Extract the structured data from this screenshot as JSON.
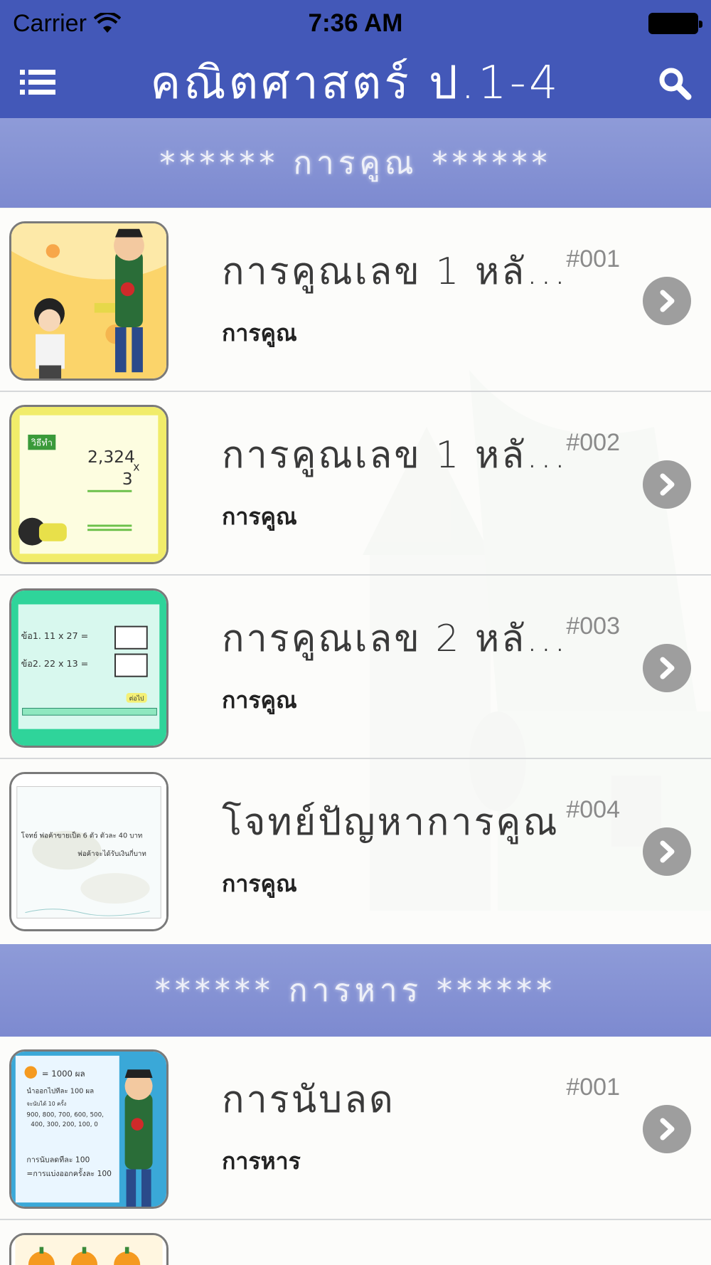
{
  "status_bar": {
    "carrier": "Carrier",
    "time": "7:36 AM"
  },
  "nav": {
    "title": "คณิตศาสตร์  ป.1-4"
  },
  "sections": [
    {
      "header": "******  การคูณ  ******",
      "items": [
        {
          "title": "การคูณเลข  1  หลั...",
          "code": "#001",
          "subtitle": "การคูณ"
        },
        {
          "title": "การคูณเลข  1  หลั...",
          "code": "#002",
          "subtitle": "การคูณ"
        },
        {
          "title": "การคูณเลข  2  หลั...",
          "code": "#003",
          "subtitle": "การคูณ"
        },
        {
          "title": "โจทย์ปัญหาการคูณ",
          "code": "#004",
          "subtitle": "การคูณ"
        }
      ]
    },
    {
      "header": "******  การหาร  ******",
      "items": [
        {
          "title": "การนับลด",
          "code": "#001",
          "subtitle": "การหาร"
        }
      ]
    }
  ],
  "thumbnails": {
    "t2": {
      "label": "วิธีทำ",
      "num1": "2,324",
      "op": "x",
      "num2": "3"
    },
    "t3": {
      "q1": "ข้อ1.   11 x 27 =",
      "q2": "ข้อ2.   22 x 13 =",
      "btn": "ต่อไป"
    },
    "t4": {
      "line1": "โจทย์  พ่อค้าขายเป็ด 6 ตัว ตัวละ 40 บาท",
      "line2": "พ่อค้าจะได้รับเงินกี่บาท"
    },
    "t5": {
      "l1": "= 1000 ผล",
      "l2": "นำออกไปทีละ 100 ผล",
      "l3": "จะนับได้ 10 ครั้ง",
      "l4": "900, 800, 700, 600, 500,",
      "l5": "400, 300, 200, 100, 0",
      "l6": "การนับลดทีละ 100",
      "l7": "=การแบ่งออกครั้งละ 100"
    }
  },
  "colors": {
    "nav": "#4358b8",
    "section": "#8592d4",
    "chevron": "#9e9e9e"
  }
}
